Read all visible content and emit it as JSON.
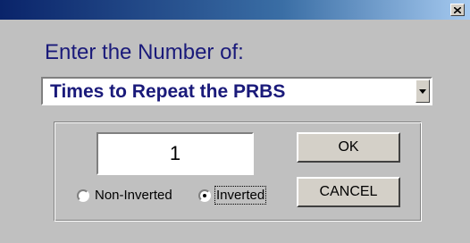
{
  "window": {
    "close_icon": "close-icon"
  },
  "prompt": "Enter the Number of:",
  "combo": {
    "selected": "Times to Repeat the PRBS",
    "dropdown_icon": "dropdown-arrow-icon"
  },
  "number_field": {
    "value": "1"
  },
  "buttons": {
    "ok": "OK",
    "cancel": "CANCEL"
  },
  "radios": {
    "non_inverted": {
      "label": "Non-Inverted",
      "checked": false
    },
    "inverted": {
      "label": "Inverted",
      "checked": true
    }
  },
  "colors": {
    "prompt_text": "#1a1a7a",
    "titlebar_start": "#0a246a",
    "titlebar_end": "#a6caf0",
    "dialog_bg": "#c0c0c0"
  }
}
